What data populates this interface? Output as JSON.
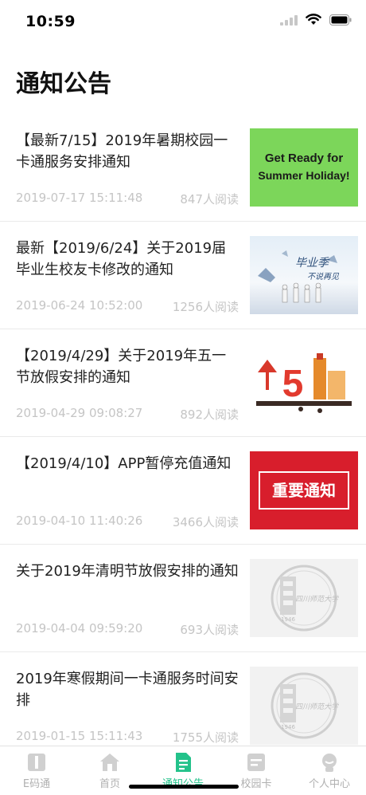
{
  "status": {
    "time": "10:59"
  },
  "page": {
    "title": "通知公告"
  },
  "notices": [
    {
      "title": "【最新7/15】2019年暑期校园一卡通服务安排通知",
      "date": "2019-07-17 15:11:48",
      "views": "847人阅读",
      "thumb_text": "Get Ready for Summer Holiday!"
    },
    {
      "title": "最新【2019/6/24】关于2019届毕业生校友卡修改的通知",
      "date": "2019-06-24 10:52:00",
      "views": "1256人阅读",
      "thumb_text": "毕业季 不说再见"
    },
    {
      "title": "【2019/4/29】关于2019年五一节放假安排的通知",
      "date": "2019-04-29 09:08:27",
      "views": "892人阅读",
      "thumb_text": "5"
    },
    {
      "title": "【2019/4/10】APP暂停充值通知",
      "date": "2019-04-10 11:40:26",
      "views": "3466人阅读",
      "thumb_text": "重要通知"
    },
    {
      "title": "关于2019年清明节放假安排的通知",
      "date": "2019-04-04 09:59:20",
      "views": "693人阅读",
      "thumb_text": "1946"
    },
    {
      "title": "2019年寒假期间一卡通服务时间安排",
      "date": "2019-01-15 15:11:43",
      "views": "1755人阅读",
      "thumb_text": "1946"
    }
  ],
  "tabs": [
    {
      "label": "E码通",
      "icon": "book-icon"
    },
    {
      "label": "首页",
      "icon": "home-icon"
    },
    {
      "label": "通知公告",
      "icon": "document-icon"
    },
    {
      "label": "校园卡",
      "icon": "card-icon"
    },
    {
      "label": "个人中心",
      "icon": "person-icon"
    }
  ],
  "colors": {
    "accent": "#23c28a",
    "muted": "#c5c5c5",
    "notice_red": "#d81e2c",
    "summer_green": "#7cd65a"
  }
}
